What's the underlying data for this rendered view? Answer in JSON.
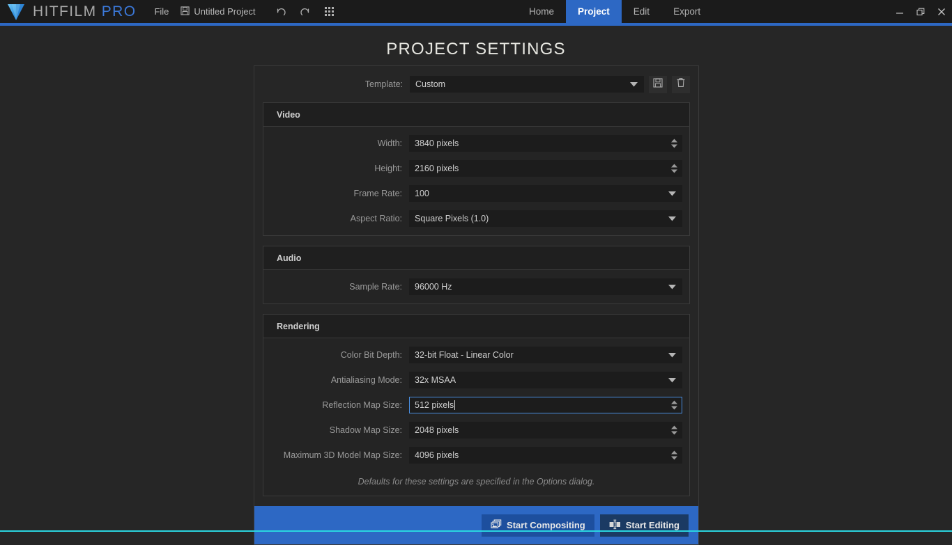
{
  "app": {
    "brand_main": "HITFILM",
    "brand_suffix": "PRO",
    "logo_icon": "hitfilm-triangle-logo"
  },
  "titlebar": {
    "menu": [
      {
        "label": "File",
        "icon": null
      },
      {
        "label": "Untitled Project",
        "icon": "save-disk-icon"
      }
    ],
    "tools": [
      {
        "name": "undo-icon"
      },
      {
        "name": "redo-icon"
      },
      {
        "name": "grid-apps-icon"
      }
    ],
    "tabs": [
      {
        "label": "Home",
        "active": false
      },
      {
        "label": "Project",
        "active": true
      },
      {
        "label": "Edit",
        "active": false
      },
      {
        "label": "Export",
        "active": false
      }
    ],
    "window_controls": [
      {
        "name": "minimize-icon"
      },
      {
        "name": "restore-icon"
      },
      {
        "name": "close-icon"
      }
    ]
  },
  "page": {
    "title": "PROJECT SETTINGS"
  },
  "template": {
    "label": "Template:",
    "value": "Custom",
    "save_icon": "floppy-save-icon",
    "delete_icon": "trash-delete-icon"
  },
  "video": {
    "heading": "Video",
    "fields": [
      {
        "label": "Width:",
        "value": "3840 pixels",
        "control": "spinner"
      },
      {
        "label": "Height:",
        "value": "2160 pixels",
        "control": "spinner"
      },
      {
        "label": "Frame Rate:",
        "value": "100",
        "control": "dropdown"
      },
      {
        "label": "Aspect Ratio:",
        "value": "Square Pixels (1.0)",
        "control": "dropdown"
      }
    ]
  },
  "audio": {
    "heading": "Audio",
    "fields": [
      {
        "label": "Sample Rate:",
        "value": "96000 Hz",
        "control": "dropdown"
      }
    ]
  },
  "rendering": {
    "heading": "Rendering",
    "fields": [
      {
        "label": "Color Bit Depth:",
        "value": "32-bit Float - Linear Color",
        "control": "dropdown",
        "focused": false
      },
      {
        "label": "Antialiasing Mode:",
        "value": "32x MSAA",
        "control": "dropdown",
        "focused": false
      },
      {
        "label": "Reflection Map Size:",
        "value": "512 pixels",
        "control": "spinner",
        "focused": true
      },
      {
        "label": "Shadow Map Size:",
        "value": "2048 pixels",
        "control": "spinner",
        "focused": false
      },
      {
        "label": "Maximum 3D Model Map Size:",
        "value": "4096 pixels",
        "control": "spinner",
        "focused": false
      }
    ],
    "note": "Defaults for these settings are specified in the Options dialog."
  },
  "footer": {
    "buttons": [
      {
        "label": "Start Compositing",
        "icon": "layered-images-icon",
        "style": "primary"
      },
      {
        "label": "Start Editing",
        "icon": "timeline-clips-icon",
        "style": "secondary"
      }
    ]
  },
  "colors": {
    "accent_blue": "#2d68c4",
    "focus_border": "#4a8ee0",
    "bottom_line": "#2ad5e0"
  }
}
